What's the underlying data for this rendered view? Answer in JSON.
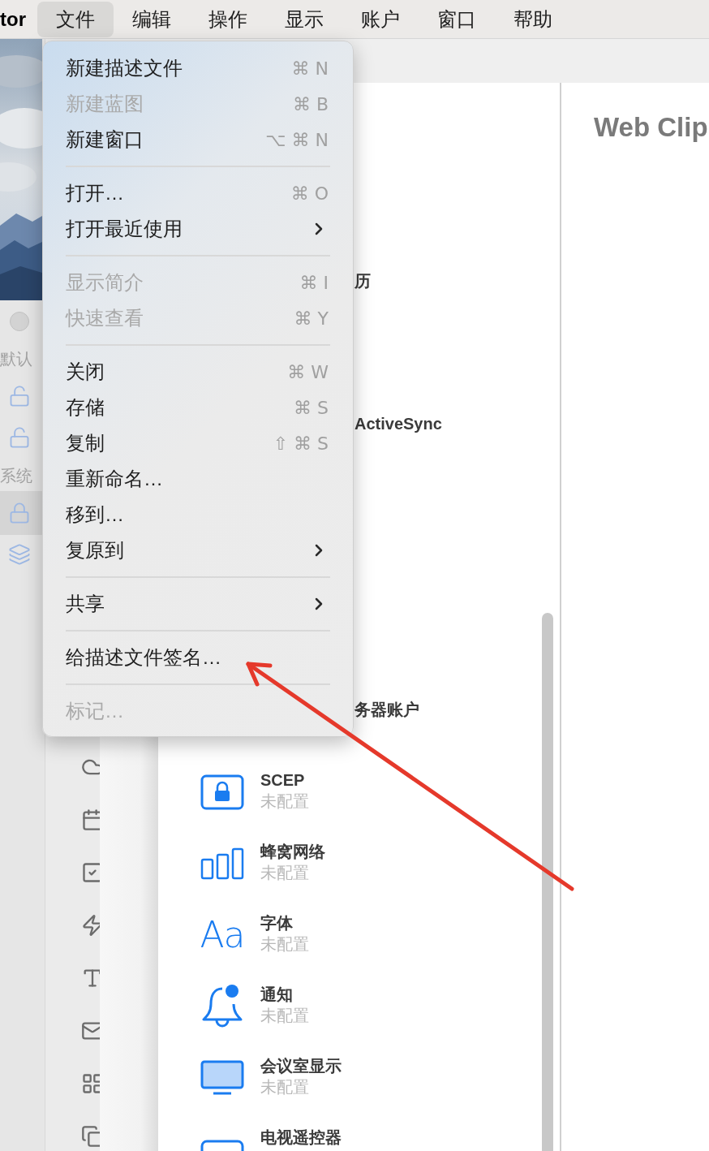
{
  "menu_bar": {
    "app_name": "tor",
    "items": [
      {
        "label": "文件",
        "selected": true
      },
      {
        "label": "编辑",
        "selected": false
      },
      {
        "label": "操作",
        "selected": false
      },
      {
        "label": "显示",
        "selected": false
      },
      {
        "label": "账户",
        "selected": false
      },
      {
        "label": "窗口",
        "selected": false
      },
      {
        "label": "帮助",
        "selected": false
      }
    ]
  },
  "background_window": {
    "sections": [
      {
        "heading": "默认",
        "items": [
          {
            "kind": "unlock",
            "selected": false
          },
          {
            "kind": "unlock",
            "selected": false
          }
        ]
      },
      {
        "heading": "系统",
        "items": [
          {
            "kind": "lock",
            "selected": true
          },
          {
            "kind": "stack",
            "selected": false
          }
        ]
      }
    ]
  },
  "file_menu": {
    "groups": [
      {
        "items": [
          {
            "label": "新建描述文件",
            "shortcut": "⌘ N",
            "kind": "command",
            "disabled": false
          },
          {
            "label": "新建蓝图",
            "shortcut": "⌘ B",
            "kind": "command",
            "disabled": true
          },
          {
            "label": "新建窗口",
            "shortcut": "⌥ ⌘ N",
            "kind": "command",
            "disabled": false
          }
        ]
      },
      {
        "items": [
          {
            "label": "打开…",
            "shortcut": "⌘ O",
            "kind": "command",
            "disabled": false
          },
          {
            "label": "打开最近使用",
            "kind": "submenu",
            "disabled": false
          }
        ]
      },
      {
        "items": [
          {
            "label": "显示简介",
            "shortcut": "⌘ I",
            "kind": "command",
            "disabled": true
          },
          {
            "label": "快速查看",
            "shortcut": "⌘ Y",
            "kind": "command",
            "disabled": true
          }
        ]
      },
      {
        "items": [
          {
            "label": "关闭",
            "shortcut": "⌘ W",
            "kind": "command",
            "disabled": false
          },
          {
            "label": "存储",
            "shortcut": "⌘ S",
            "kind": "command",
            "disabled": false
          },
          {
            "label": "复制",
            "shortcut": "⇧ ⌘ S",
            "kind": "command",
            "disabled": false
          },
          {
            "label": "重新命名…",
            "kind": "command",
            "disabled": false
          },
          {
            "label": "移到…",
            "kind": "command",
            "disabled": false
          },
          {
            "label": "复原到",
            "kind": "submenu",
            "disabled": false
          }
        ]
      },
      {
        "items": [
          {
            "label": "共享",
            "kind": "submenu",
            "disabled": false
          }
        ]
      },
      {
        "items": [
          {
            "label": "给描述文件签名…",
            "kind": "command",
            "disabled": false
          }
        ]
      },
      {
        "items": [
          {
            "label": "标记…",
            "kind": "command",
            "disabled": true
          }
        ]
      }
    ]
  },
  "payload_list": {
    "covered_titles": [
      "历",
      "ActiveSync",
      "务器账户"
    ],
    "rows": [
      {
        "kind": "lock",
        "title": "SCEP",
        "status": "未配置"
      },
      {
        "kind": "cellular",
        "title": "蜂窝网络",
        "status": "未配置"
      },
      {
        "kind": "font",
        "glyph": "Aa",
        "title": "字体",
        "status": "未配置"
      },
      {
        "kind": "bell",
        "title": "通知",
        "status": "未配置"
      },
      {
        "kind": "display",
        "title": "会议室显示",
        "status": "未配置"
      },
      {
        "kind": "tv",
        "title": "电视遥控器"
      }
    ]
  },
  "detail_pane": {
    "title": "Web Clip"
  }
}
